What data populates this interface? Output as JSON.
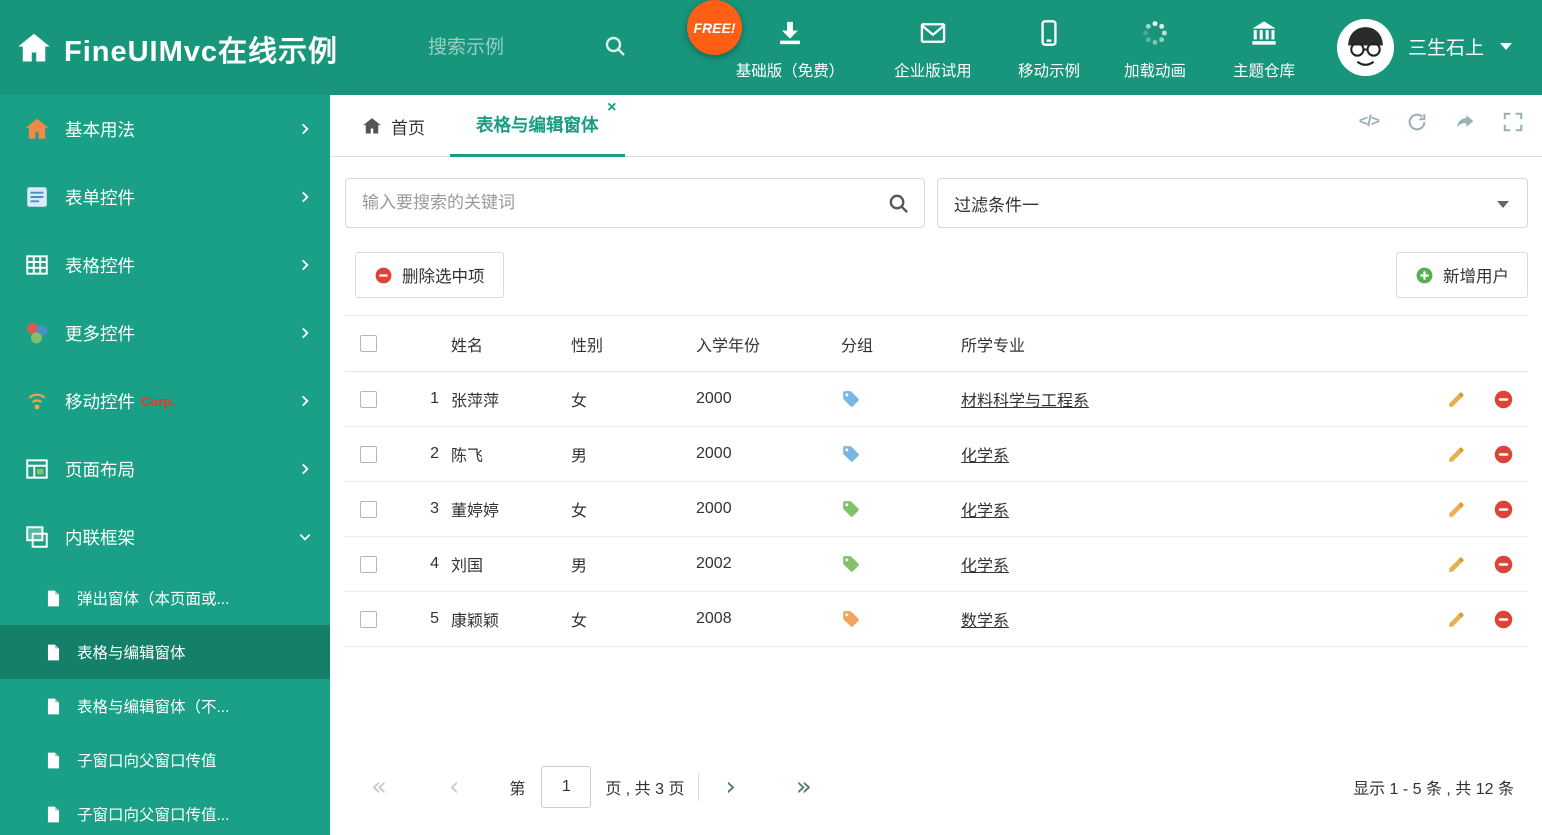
{
  "colors": {
    "header_bg": "#17967c",
    "sidebar_bg": "#1aa086",
    "accent": "#1b9c82",
    "free_badge": "#ff5f14",
    "delete_red": "#dd4336",
    "add_green": "#58ae52",
    "pencil_gold": "#e6b14d"
  },
  "header": {
    "title": "FineUIMvc在线示例",
    "search_placeholder": "搜索示例",
    "free_badge": "FREE!",
    "nav": [
      {
        "label": "基础版（免费）",
        "icon": "download-icon"
      },
      {
        "label": "企业版试用",
        "icon": "envelope-icon"
      },
      {
        "label": "移动示例",
        "icon": "mobile-icon"
      },
      {
        "label": "加载动画",
        "icon": "spinner-icon"
      },
      {
        "label": "主题仓库",
        "icon": "bank-icon"
      }
    ],
    "user_name": "三生石上"
  },
  "sidebar": {
    "items": [
      {
        "label": "基本用法",
        "icon": "home-icon"
      },
      {
        "label": "表单控件",
        "icon": "form-icon"
      },
      {
        "label": "表格控件",
        "icon": "table-icon"
      },
      {
        "label": "更多控件",
        "icon": "widgets-icon"
      },
      {
        "label": "移动控件",
        "badge": "Corp.",
        "icon": "mobile-signal-icon"
      },
      {
        "label": "页面布局",
        "icon": "layout-icon"
      },
      {
        "label": "内联框架",
        "icon": "frame-icon"
      }
    ],
    "subitems": [
      {
        "label": "弹出窗体（本页面或..."
      },
      {
        "label": "表格与编辑窗体"
      },
      {
        "label": "表格与编辑窗体（不..."
      },
      {
        "label": "子窗口向父窗口传值"
      },
      {
        "label": "子窗口向父窗口传值..."
      }
    ]
  },
  "tabs": {
    "home_label": "首页",
    "active_label": "表格与编辑窗体",
    "close_glyph": "×",
    "code_glyph": "</>"
  },
  "filter_bar": {
    "search_placeholder": "输入要搜索的关键词",
    "filter_selected": "过滤条件一"
  },
  "toolbar": {
    "delete_label": "删除选中项",
    "add_label": "新增用户"
  },
  "table": {
    "headers": {
      "name": "姓名",
      "gender": "性别",
      "year": "入学年份",
      "group": "分组",
      "major": "所学专业"
    },
    "rows": [
      {
        "num": "1",
        "name": "张萍萍",
        "gender": "女",
        "year": "2000",
        "tag": "blue",
        "major": "材料科学与工程系"
      },
      {
        "num": "2",
        "name": "陈飞",
        "gender": "男",
        "year": "2000",
        "tag": "blue",
        "major": "化学系"
      },
      {
        "num": "3",
        "name": "董婷婷",
        "gender": "女",
        "year": "2000",
        "tag": "green",
        "major": "化学系"
      },
      {
        "num": "4",
        "name": "刘国",
        "gender": "男",
        "year": "2002",
        "tag": "green",
        "major": "化学系"
      },
      {
        "num": "5",
        "name": "康颖颖",
        "gender": "女",
        "year": "2008",
        "tag": "orange",
        "major": "数学系"
      }
    ]
  },
  "pagination": {
    "prefix": "第",
    "current_page": "1",
    "suffix": "页 , 共 3 页",
    "first_glyph": "«",
    "prev_glyph": "‹",
    "next_glyph": "›",
    "last_glyph": "»",
    "summary": "显示 1 - 5 条 , 共 12 条"
  }
}
